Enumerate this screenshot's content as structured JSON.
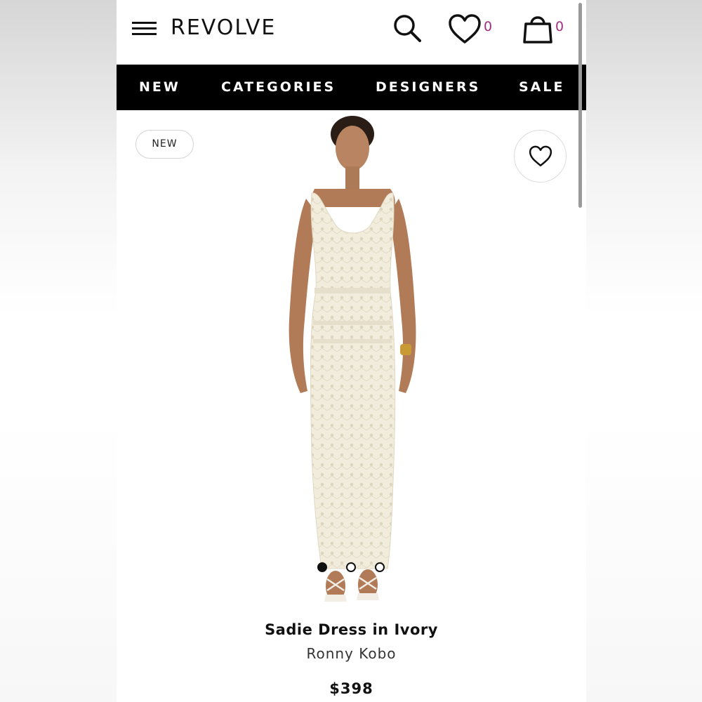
{
  "header": {
    "logo": "REVOLVE",
    "wishlist_count": "0",
    "bag_count": "0",
    "accent_color": "#a0307f"
  },
  "nav": {
    "items": [
      {
        "label": "NEW"
      },
      {
        "label": "CATEGORIES"
      },
      {
        "label": "DESIGNERS"
      },
      {
        "label": "SALE"
      }
    ]
  },
  "product": {
    "badge": "NEW",
    "name": "Sadie Dress in Ivory",
    "brand": "Ronny Kobo",
    "price": "$398",
    "image_count": 3,
    "active_image_index": 0
  },
  "icons": [
    "menu-icon",
    "search-icon",
    "heart-icon",
    "bag-icon"
  ]
}
